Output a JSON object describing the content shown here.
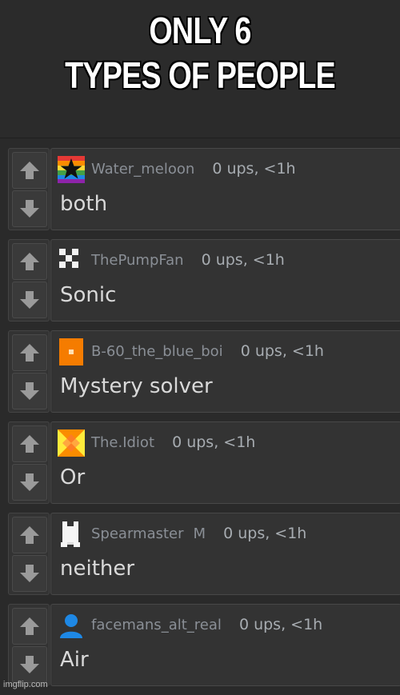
{
  "meme": {
    "title_line1": "ONLY 6",
    "title_line2": "TYPES OF PEOPLE"
  },
  "comments": [
    {
      "username": "Water_meloon",
      "flag": "",
      "stats": "0 ups, <1h",
      "text": "both",
      "avatar_icon": "rainbow-star-avatar-icon"
    },
    {
      "username": "ThePumpFan",
      "flag": "",
      "stats": "0 ups, <1h",
      "text": "Sonic",
      "avatar_icon": "pixel-cross-avatar-icon"
    },
    {
      "username": "B-60_the_blue_boi",
      "flag": "",
      "stats": "0 ups, <1h",
      "text": "Mystery solver",
      "avatar_icon": "orange-square-avatar-icon"
    },
    {
      "username": "The.Idiot",
      "flag": "",
      "stats": "0 ups, <1h",
      "text": "Or",
      "avatar_icon": "pinwheel-avatar-icon"
    },
    {
      "username": "Spearmaster",
      "flag": "M",
      "stats": "0 ups, <1h",
      "text": "neither",
      "avatar_icon": "white-pixel-figure-avatar-icon"
    },
    {
      "username": "facemans_alt_real",
      "flag": "",
      "stats": "0 ups, <1h",
      "text": "Air",
      "avatar_icon": "default-user-avatar-icon"
    }
  ],
  "watermark": "imgflip.com",
  "colors": {
    "background": "#2a2a2a",
    "comment_bg": "#333333",
    "username": "#8a8f96",
    "text": "#d9d9d9"
  }
}
